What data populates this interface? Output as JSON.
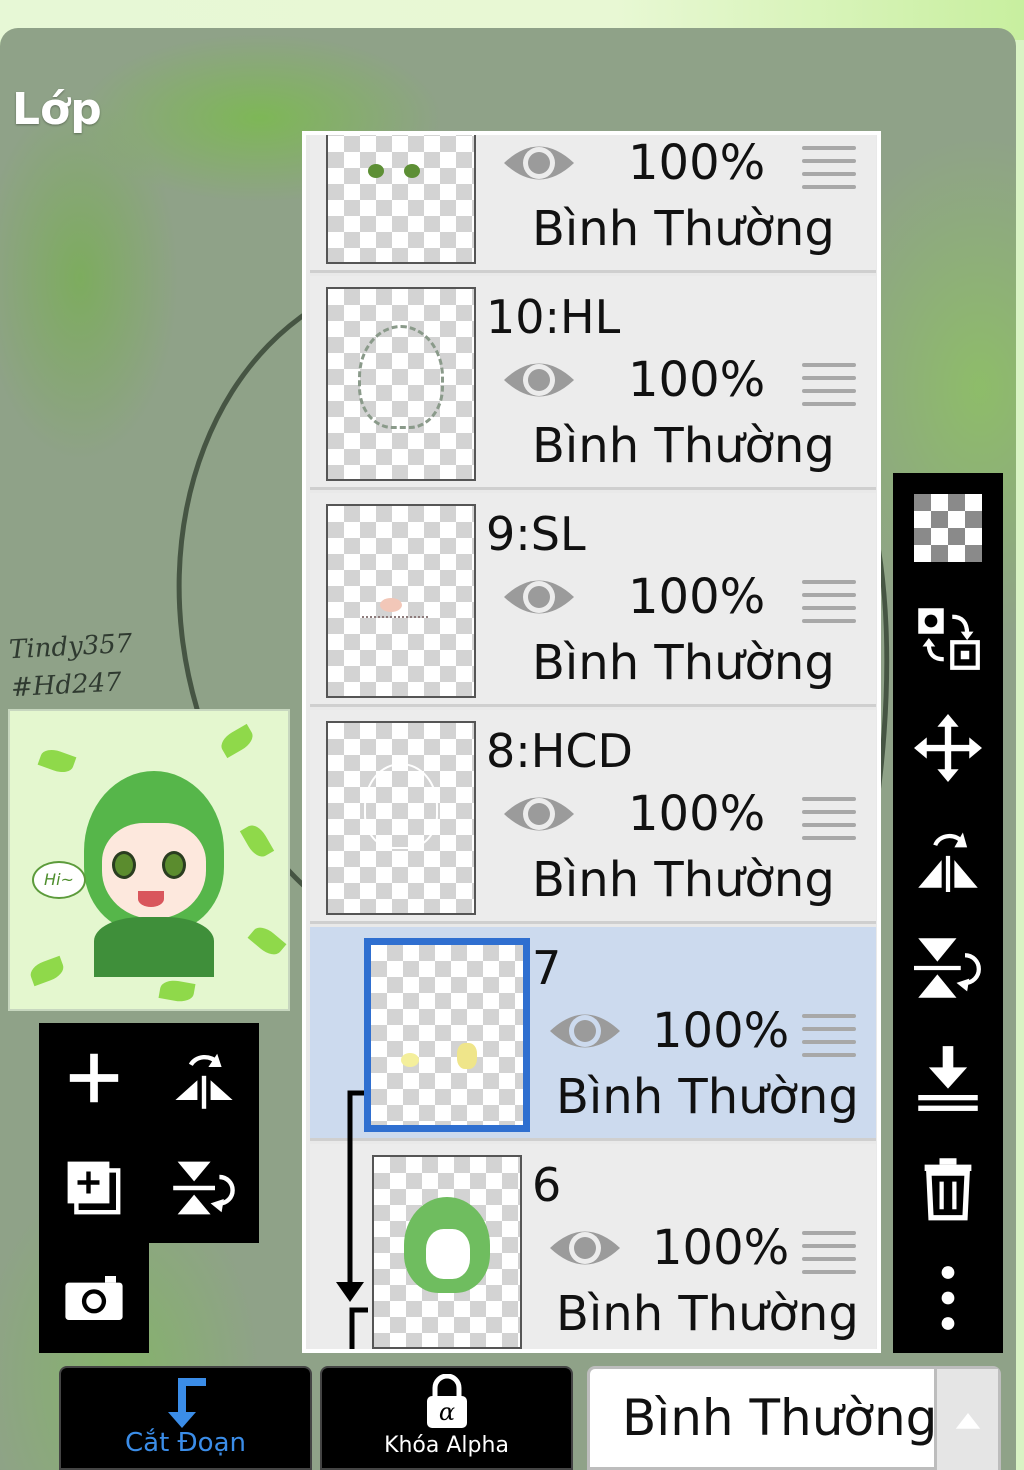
{
  "panel": {
    "title": "Lớp"
  },
  "artwork": {
    "signature_line1": "Tindy357",
    "signature_line2": "#Hd247"
  },
  "layers": [
    {
      "name": "",
      "opacity": "100%",
      "blend": "Bình Thường",
      "selected": false
    },
    {
      "name": "10:HL",
      "opacity": "100%",
      "blend": "Bình Thường",
      "selected": false
    },
    {
      "name": "9:SL",
      "opacity": "100%",
      "blend": "Bình Thường",
      "selected": false
    },
    {
      "name": "8:HCD",
      "opacity": "100%",
      "blend": "Bình Thường",
      "selected": false
    },
    {
      "name": "7",
      "opacity": "100%",
      "blend": "Bình Thường",
      "selected": true,
      "clipped": true
    },
    {
      "name": "6",
      "opacity": "100%",
      "blend": "Bình Thường",
      "selected": false,
      "clipped": true
    }
  ],
  "left_tools": [
    "plus-icon",
    "flip-horizontal-icon",
    "duplicate-layer-icon",
    "flip-vertical-icon",
    "camera-icon"
  ],
  "right_tools": [
    "transparency-icon",
    "swap-icon",
    "move-icon",
    "flip-horizontal-icon",
    "flip-vertical-icon",
    "merge-down-icon",
    "trash-icon",
    "more-vertical-icon"
  ],
  "bottom_bar": {
    "clip_label": "Cắt Đoạn",
    "alpha_lock_label": "Khóa Alpha",
    "blend_mode_value": "Bình Thường"
  },
  "colors": {
    "accent_blue": "#2f6fd0",
    "clip_label_color": "#3b8de8",
    "selected_row": "#ccdaee"
  }
}
